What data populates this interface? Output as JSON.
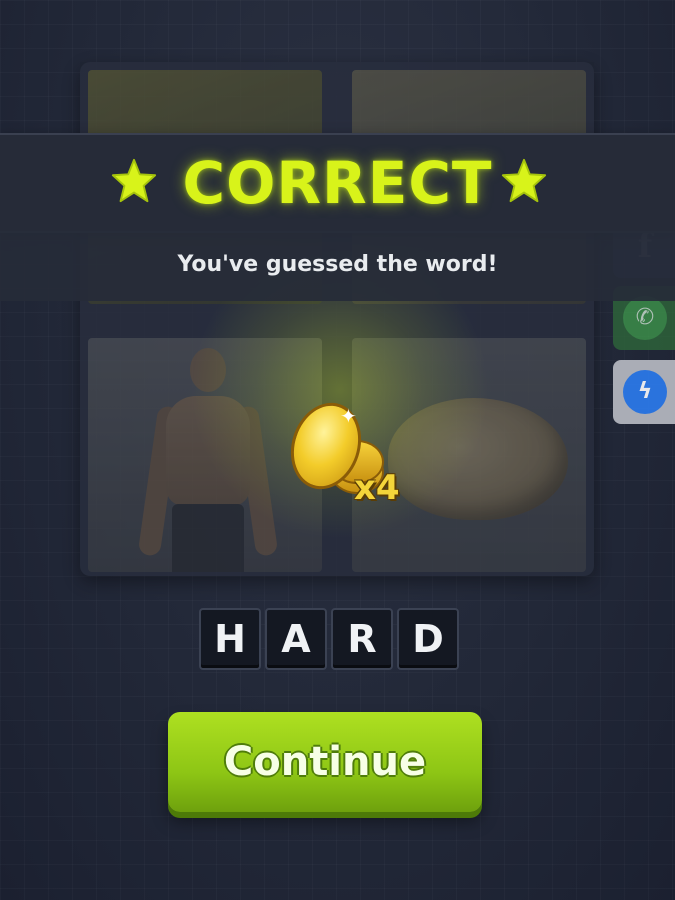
{
  "banner": {
    "title": "CORRECT",
    "subtitle": "You've guessed the word!",
    "accent_color": "#d8f31a"
  },
  "puzzle": {
    "images": [
      {
        "name": "image-1"
      },
      {
        "name": "image-2"
      },
      {
        "name": "shirtless-man"
      },
      {
        "name": "walnut"
      }
    ],
    "answer_letters": [
      "H",
      "A",
      "R",
      "D"
    ]
  },
  "reward": {
    "multiplier_label": "x4",
    "icon": "coin-icon"
  },
  "share": {
    "icons": [
      "facebook-icon",
      "whatsapp-icon",
      "messenger-icon"
    ]
  },
  "actions": {
    "continue_label": "Continue",
    "button_color": "#8ec615"
  }
}
